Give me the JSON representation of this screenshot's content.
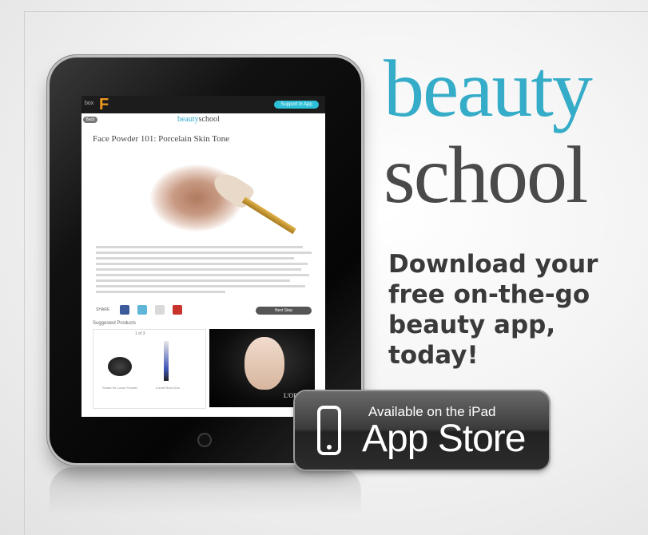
{
  "ipad_screen": {
    "topbar_logo_prefix": "box",
    "topbar_logo": "F",
    "support_button": "Support in App",
    "back_button": "Back",
    "brand_part1": "beauty",
    "brand_part2": "school",
    "article_title": "Face Powder 101: Porcelain Skin Tone",
    "share_label": "SHARE",
    "next_button": "Next Step",
    "suggested_label": "Suggested Products",
    "pager": "1 of 3",
    "product_1": "Shade Kit Loose Powder",
    "product_2": "Loreal Brow Duo",
    "ad_brand": "L'ORÉAL"
  },
  "headline": {
    "line1": "beauty",
    "line2": "school"
  },
  "tagline": {
    "line1": "Download your",
    "line2": "free on-the-go",
    "line3": "beauty app, today!"
  },
  "badge": {
    "small_text": "Available on the iPad",
    "big_text": "App Store"
  },
  "colors": {
    "accent": "#35acc8",
    "text_dark": "#4a4a4a",
    "badge_bg": "#333333"
  }
}
